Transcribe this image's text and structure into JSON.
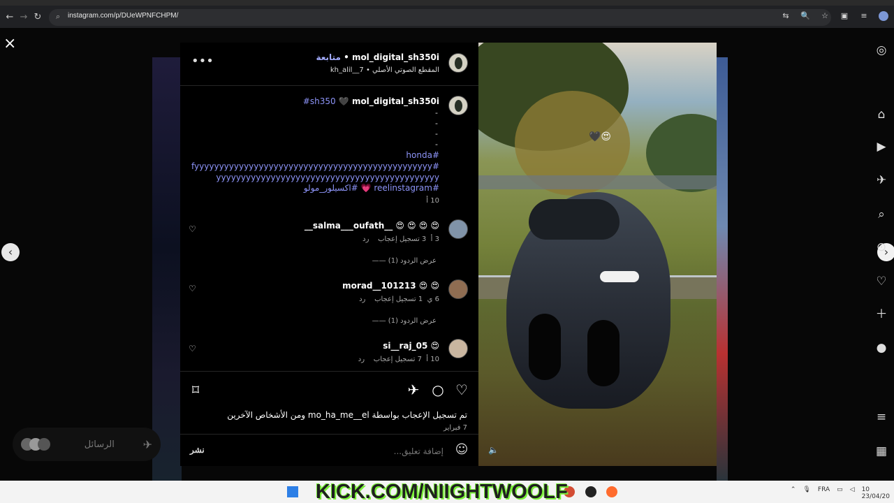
{
  "browser": {
    "url": "instagram.com/p/DUeWPNFCHPM/",
    "url_icon": "page-info-icon",
    "nav_icons": [
      "back-icon",
      "forward-icon",
      "refresh-icon"
    ],
    "toolbar_icons": [
      "translate-icon",
      "zoom-icon",
      "bookmark-star-icon",
      "extensions-icon",
      "menu-lines-icon",
      "profile-avatar"
    ]
  },
  "instagram": {
    "close_icon": "close-icon",
    "left_nav_icon": "chevron-left-icon",
    "right_nav_icon": "chevron-right-icon",
    "messages": {
      "label": "الرسائل",
      "icon": "send-icon"
    },
    "right_icons": [
      "instagram-logo-icon",
      "home-icon",
      "reels-icon",
      "direct-icon",
      "search-icon",
      "explore-icon",
      "heart-icon",
      "create-icon",
      "profile-icon",
      "menu-icon",
      "apps-icon"
    ]
  },
  "post": {
    "header": {
      "username": "mol_digital_sh350i",
      "follow": "متابعة",
      "audio": "المقطع الصوتي الأصلي • kh_alil__7"
    },
    "caption": {
      "username": "mol_digital_sh350i",
      "heart": "🖤",
      "tag_1": "#sh350",
      "dashes": [
        "-",
        "-",
        "-",
        "-"
      ],
      "hashtags": [
        "#honda",
        "#fyyyyyyyyyyyyyyyyyyyyyyyyyyyyyyyyyyyyyyyyyyyyyyyy",
        "yyyyyyyyyyyyyyyyyyyyyyyyyyyyyyyyyyyyyyyyyyyyy",
        "#reelinstagram 💗 #اكسيلور_مولو"
      ],
      "age": "10 أ"
    },
    "comments": [
      {
        "username": "__salma___oufath__",
        "text": "😍 😍 😍 😍",
        "age": "3 أ",
        "likes": "3 تسجيل إعجاب",
        "reply": "رد",
        "view_replies": "عرض الردود (1)"
      },
      {
        "username": "morad__101213",
        "text": "😍 😍",
        "age": "6 ي",
        "likes": "1 تسجيل إعجاب",
        "reply": "رد",
        "view_replies": "عرض الردود (1)"
      },
      {
        "username": "si__raj_05",
        "text": "😍",
        "age": "10 أ",
        "likes": "7 تسجيل إعجاب",
        "reply": "رد"
      }
    ],
    "actions": {
      "like": "heart-icon",
      "comment": "comment-icon",
      "share": "share-icon",
      "save": "bookmark-icon"
    },
    "likes_text": "تم تسجيل الإعجاب بواسطة mo_ha_me__el ومن الأشخاص الآخرين",
    "date": "7 فبراير",
    "comment_input": {
      "placeholder": "إضافة تعليق...",
      "post": "نشر",
      "emoji": "smile-icon"
    },
    "media": {
      "emojis": "🖤😍",
      "sound_icon": "speaker-icon"
    }
  },
  "taskbar": {
    "kick_text": "KICK.COM/NIIGHTWOOLF",
    "lang": "FRA",
    "date": "23/04/20",
    "time": "10"
  },
  "colors": {
    "background": "#070707",
    "accent": "#8d94f8",
    "link": "#a3acff"
  }
}
